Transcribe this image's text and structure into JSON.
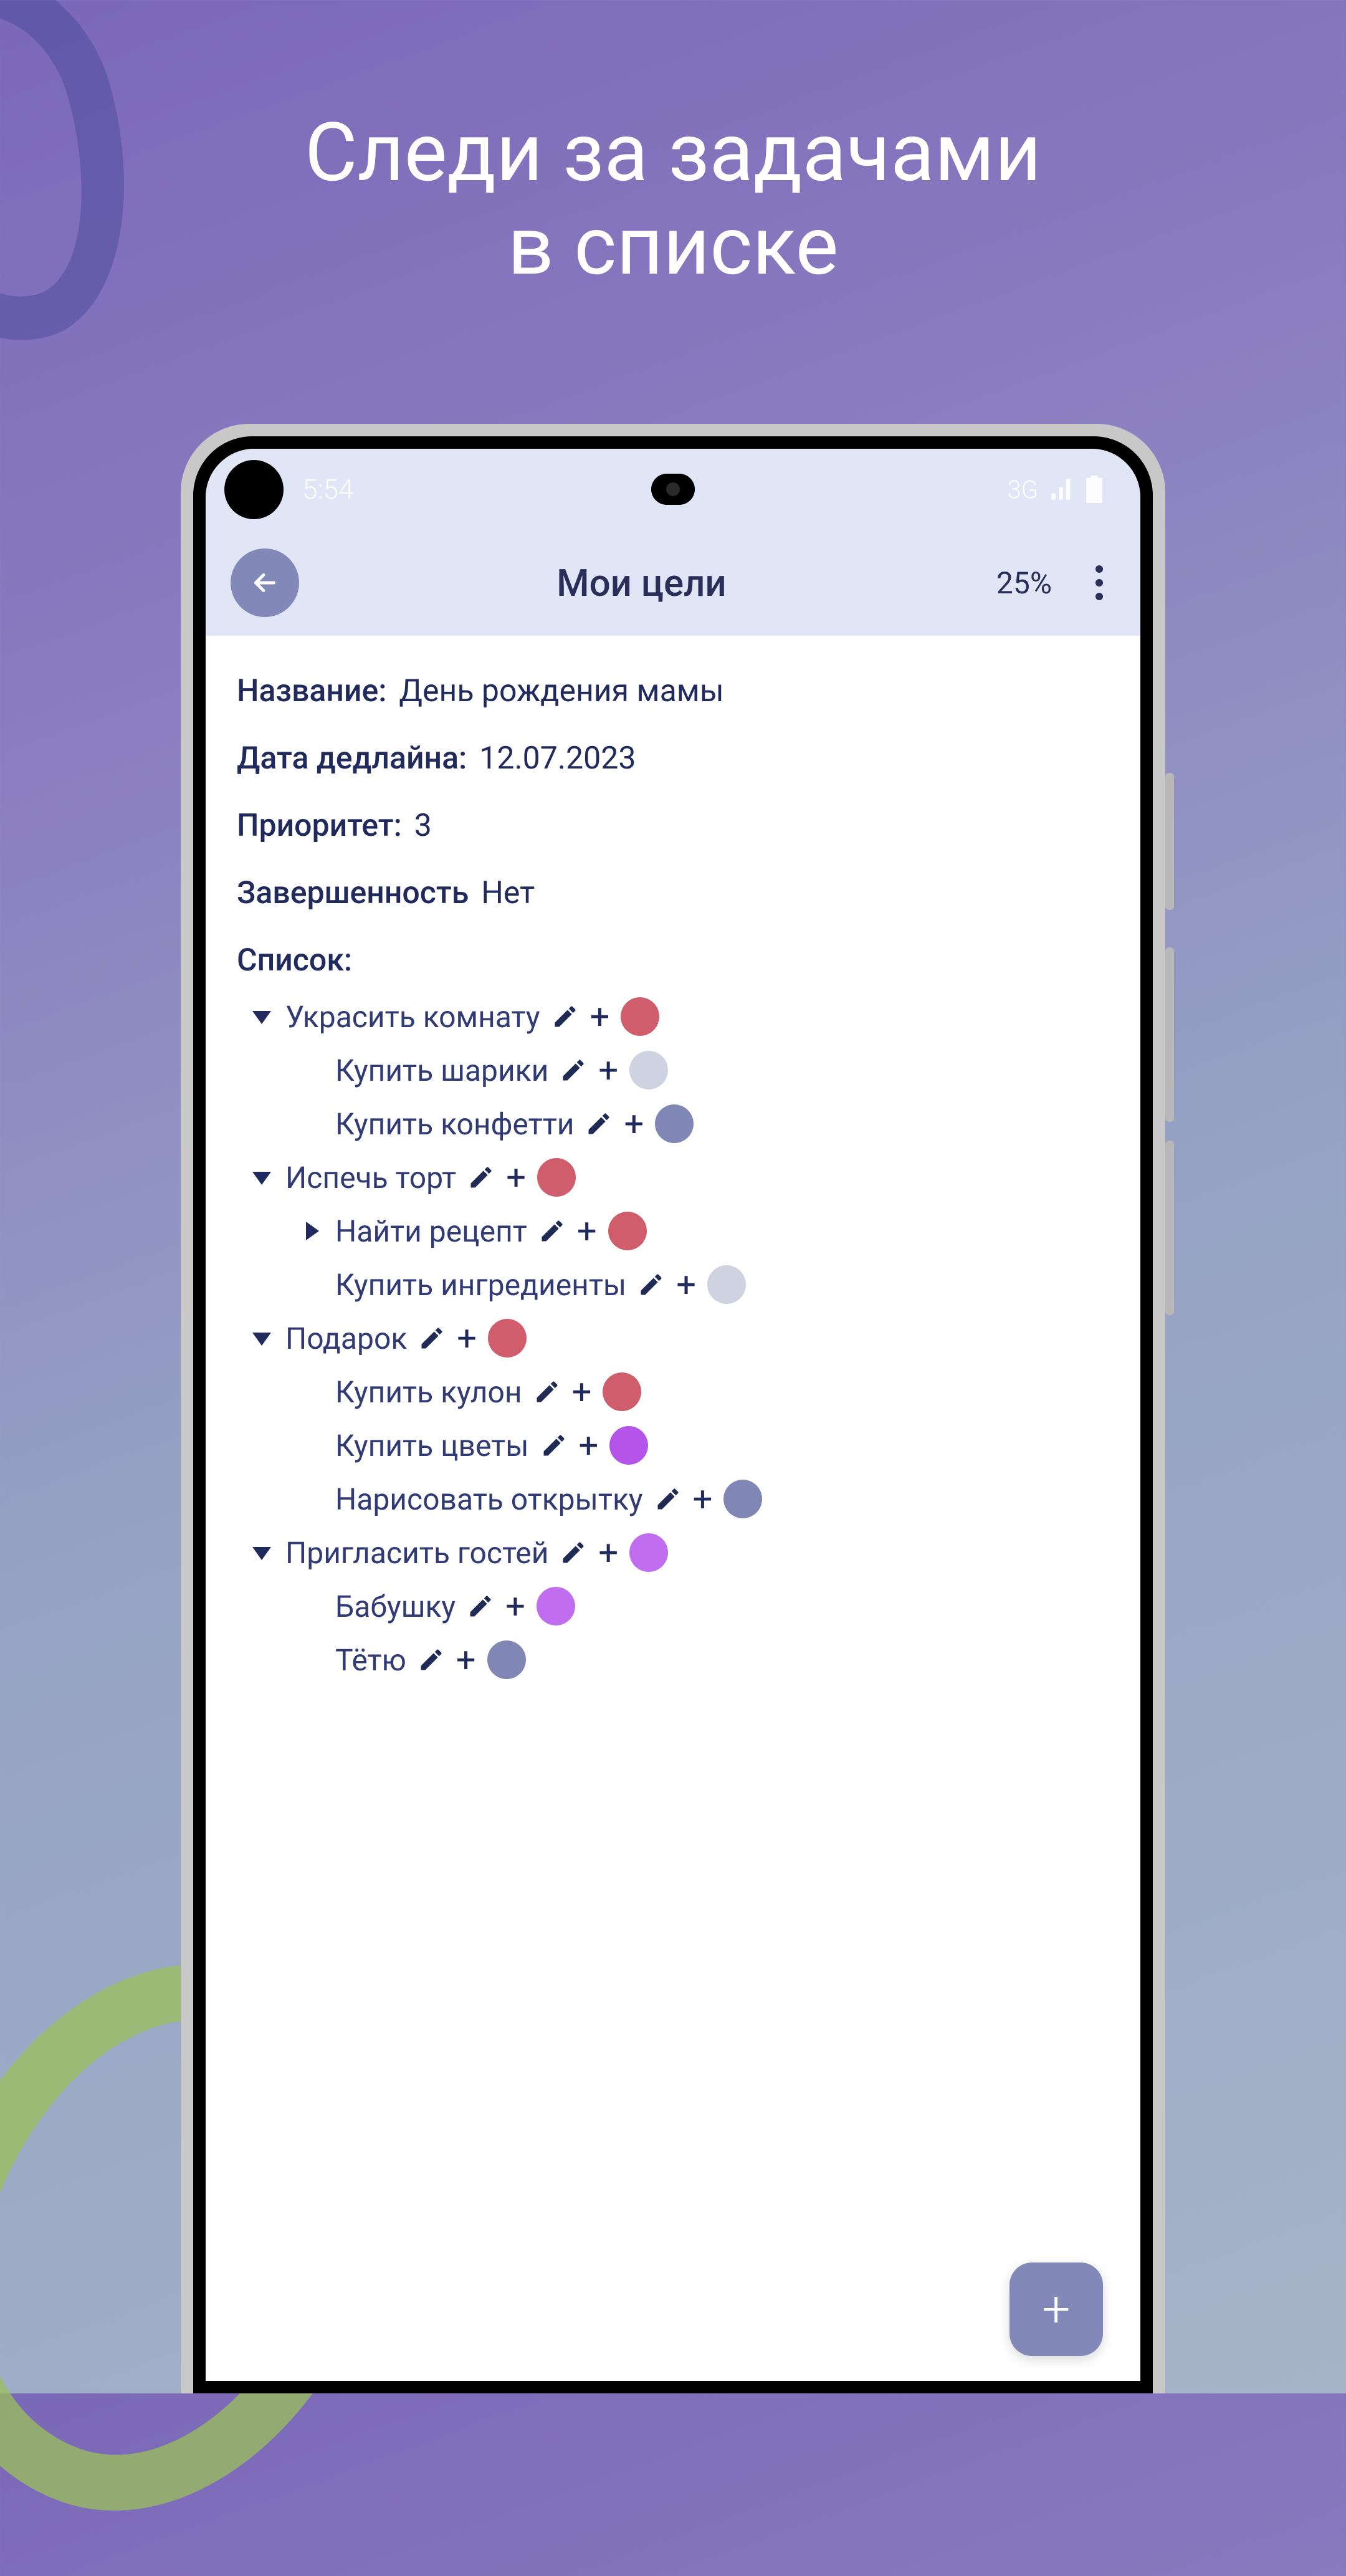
{
  "promo": {
    "line1": "Следи за задачами",
    "line2": "в списке"
  },
  "statusbar": {
    "time": "5:54",
    "net": "3G"
  },
  "appbar": {
    "title": "Мои цели",
    "progress": "25%"
  },
  "fields": {
    "name_label": "Название:",
    "name_value": "День рождения мамы",
    "deadline_label": "Дата дедлайна:",
    "deadline_value": "12.07.2023",
    "priority_label": "Приоритет:",
    "priority_value": "3",
    "completed_label": "Завершенность",
    "completed_value": "Нет",
    "list_label": "Список:"
  },
  "colors": {
    "red": "#cf5d6c",
    "grey": "#cfd2e0",
    "slate": "#8187b4",
    "purple": "#b454e8",
    "violet": "#c06df0"
  },
  "tree": [
    {
      "level": 0,
      "caret": "down",
      "label": "Украсить комнату",
      "color": "red"
    },
    {
      "level": 1,
      "caret": "",
      "label": "Купить шарики",
      "color": "grey"
    },
    {
      "level": 1,
      "caret": "",
      "label": "Купить конфетти",
      "color": "slate"
    },
    {
      "level": 0,
      "caret": "down",
      "label": "Испечь торт",
      "color": "red"
    },
    {
      "level": 1,
      "caret": "right",
      "label": "Найти рецепт",
      "color": "red"
    },
    {
      "level": 1,
      "caret": "",
      "label": "Купить ингредиенты",
      "color": "grey"
    },
    {
      "level": 0,
      "caret": "down",
      "label": "Подарок",
      "color": "red"
    },
    {
      "level": 1,
      "caret": "",
      "label": "Купить кулон",
      "color": "red"
    },
    {
      "level": 1,
      "caret": "",
      "label": "Купить цветы",
      "color": "purple"
    },
    {
      "level": 1,
      "caret": "",
      "label": "Нарисовать открытку",
      "color": "slate"
    },
    {
      "level": 0,
      "caret": "down",
      "label": "Пригласить гостей",
      "color": "violet"
    },
    {
      "level": 1,
      "caret": "",
      "label": "Бабушку",
      "color": "violet"
    },
    {
      "level": 1,
      "caret": "",
      "label": "Тётю",
      "color": "slate"
    }
  ],
  "fab": "+"
}
